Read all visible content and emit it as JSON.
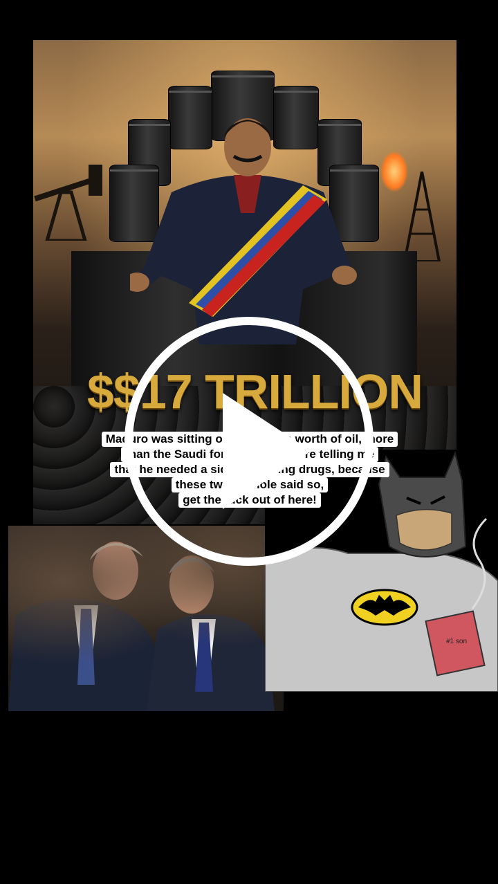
{
  "video": {
    "overlay_text": "$$17 TRILLION",
    "caption_lines": [
      "Maduro was sitting on $17 trillion worth of oil, more",
      "than the Saudi fortune, and you’re telling me",
      "that he needed a side gig selling drugs, because",
      "these two asshole said so,",
      "get the fuck out of here!"
    ],
    "mug_text": "#1 son"
  },
  "controls": {
    "play_icon": "play-icon"
  }
}
